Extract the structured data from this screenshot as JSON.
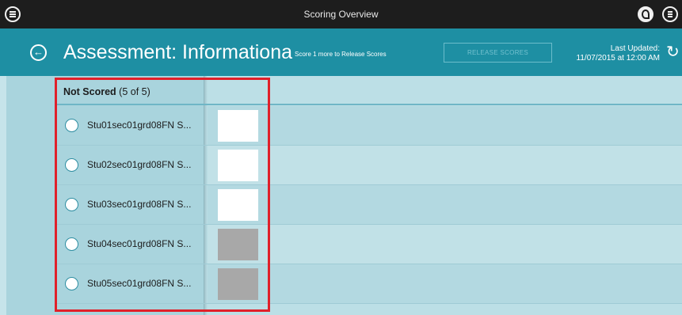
{
  "topbar": {
    "title": "Scoring Overview"
  },
  "header": {
    "assessment_title": "Assessment: Informational R…",
    "score_note": "Score 1 more to Release Scores",
    "release_label": "RELEASE SCORES",
    "last_updated_label": "Last Updated:",
    "last_updated_value": "11/07/2015 at 12:00 AM"
  },
  "section": {
    "label": "Not Scored",
    "count": "(5 of 5)"
  },
  "students": [
    {
      "name": "Stu01sec01grd08FN S...",
      "status_color": "#ffffff"
    },
    {
      "name": "Stu02sec01grd08FN S...",
      "status_color": "#ffffff"
    },
    {
      "name": "Stu03sec01grd08FN S...",
      "status_color": "#ffffff"
    },
    {
      "name": "Stu04sec01grd08FN S...",
      "status_color": "#a8a8a8"
    },
    {
      "name": "Stu05sec01grd08FN S...",
      "status_color": "#a8a8a8"
    }
  ],
  "colors": {
    "topbar": "#1d1d1d",
    "header": "#1e8fa3",
    "highlight": "#e0202a"
  }
}
